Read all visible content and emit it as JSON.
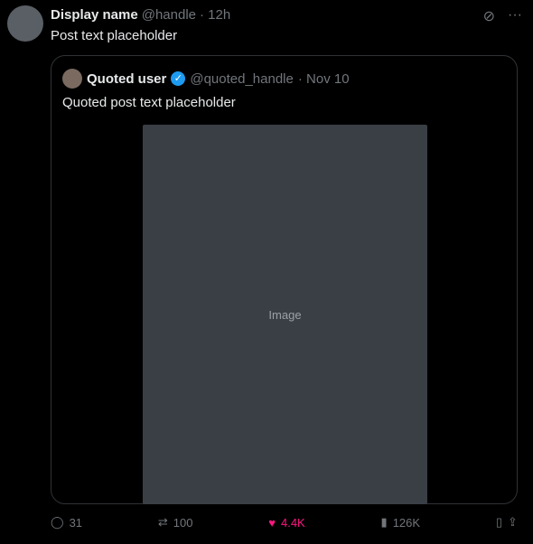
{
  "post": {
    "display_name": "Display name",
    "handle": "@handle",
    "time": "· 12h",
    "text": "Post text placeholder"
  },
  "quote": {
    "display_name": "Quoted user",
    "handle": "@quoted_handle",
    "time": "· Nov 10",
    "text": "Quoted post text placeholder",
    "media_label": "Image"
  },
  "actions": {
    "replies": "31",
    "reposts": "100",
    "likes": "4.4K",
    "views": "126K"
  },
  "colors": {
    "accent": "#1d9bf0",
    "like": "#f91880",
    "muted": "#71767b",
    "border": "#2f3336"
  }
}
